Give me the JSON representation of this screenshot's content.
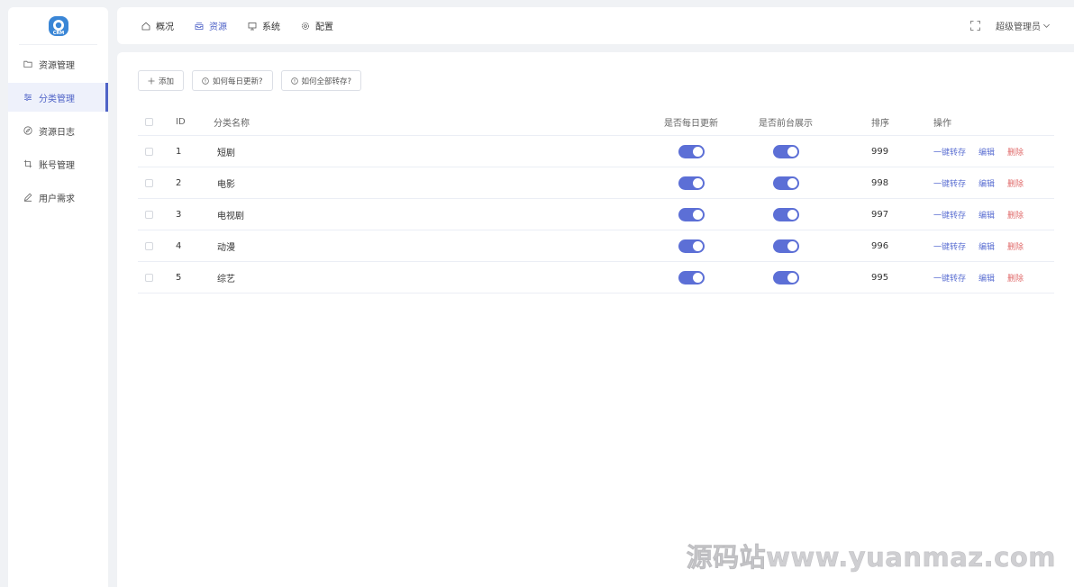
{
  "sidebar": {
    "logo_text": "CRM",
    "items": [
      {
        "label": "资源管理",
        "icon": "folder-icon",
        "active": false
      },
      {
        "label": "分类管理",
        "icon": "sliders-icon",
        "active": true
      },
      {
        "label": "资源日志",
        "icon": "compass-icon",
        "active": false
      },
      {
        "label": "账号管理",
        "icon": "crop-icon",
        "active": false
      },
      {
        "label": "用户需求",
        "icon": "pen-icon",
        "active": false
      }
    ]
  },
  "topbar": {
    "menu": [
      {
        "label": "概况",
        "icon": "home-icon",
        "active": false
      },
      {
        "label": "资源",
        "icon": "inbox-icon",
        "active": true
      },
      {
        "label": "系统",
        "icon": "monitor-icon",
        "active": false
      },
      {
        "label": "配置",
        "icon": "gear-icon",
        "active": false
      }
    ],
    "user": "超级管理员"
  },
  "toolbar": {
    "add_label": "添加",
    "daily_help_label": "如何每日更新?",
    "transfer_help_label": "如何全部转存?"
  },
  "table": {
    "headers": {
      "id": "ID",
      "name": "分类名称",
      "daily": "是否每日更新",
      "front": "是否前台展示",
      "sort": "排序",
      "ops": "操作"
    },
    "rows": [
      {
        "id": "1",
        "name": "短剧",
        "daily": true,
        "front": true,
        "sort": "999"
      },
      {
        "id": "2",
        "name": "电影",
        "daily": true,
        "front": true,
        "sort": "998"
      },
      {
        "id": "3",
        "name": "电视剧",
        "daily": true,
        "front": true,
        "sort": "997"
      },
      {
        "id": "4",
        "name": "动漫",
        "daily": true,
        "front": true,
        "sort": "996"
      },
      {
        "id": "5",
        "name": "综艺",
        "daily": true,
        "front": true,
        "sort": "995"
      }
    ],
    "ops": {
      "transfer": "一键转存",
      "edit": "编辑",
      "delete": "删除"
    }
  },
  "colors": {
    "accent": "#4f63c7",
    "switch_on": "#5c6fd6",
    "danger": "#e06a6a"
  },
  "watermark": "源码站www.yuanmaz.com"
}
